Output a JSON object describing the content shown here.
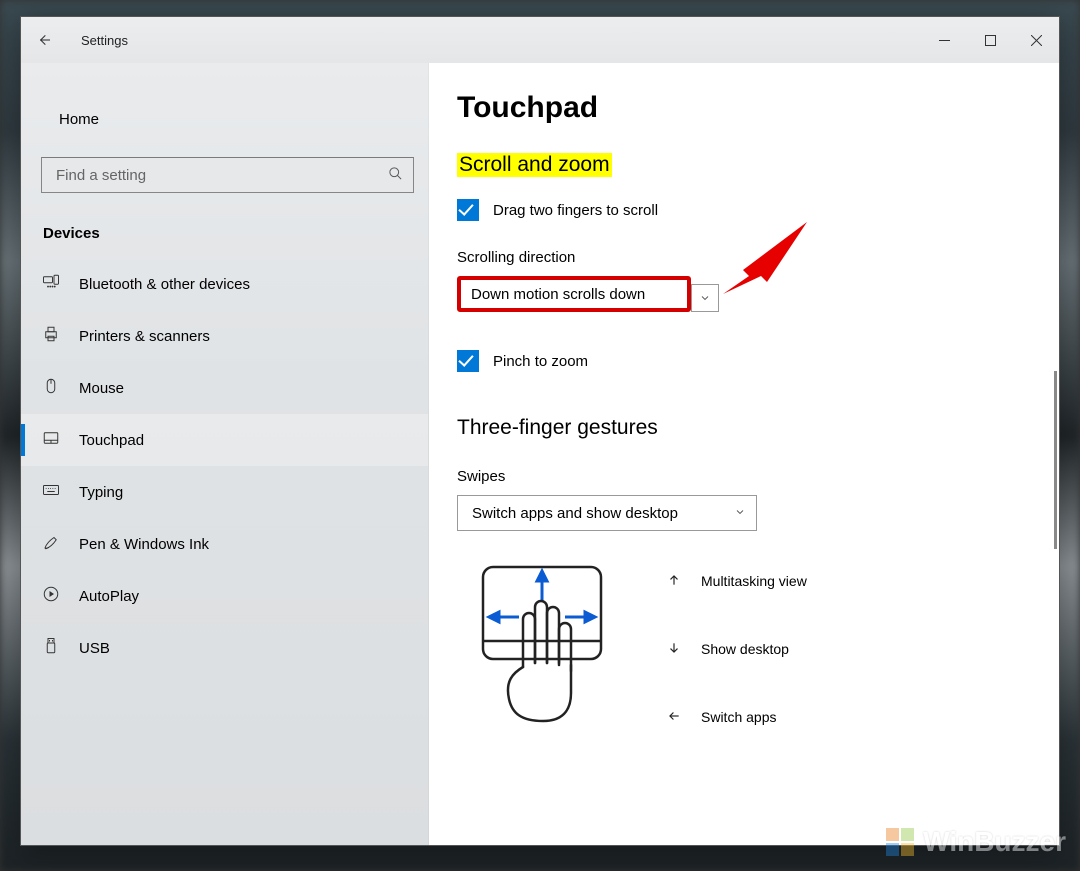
{
  "window": {
    "title": "Settings"
  },
  "sidebar": {
    "home_label": "Home",
    "search_placeholder": "Find a setting",
    "category": "Devices",
    "items": [
      {
        "label": "Bluetooth & other devices"
      },
      {
        "label": "Printers & scanners"
      },
      {
        "label": "Mouse"
      },
      {
        "label": "Touchpad",
        "selected": true
      },
      {
        "label": "Typing"
      },
      {
        "label": "Pen & Windows Ink"
      },
      {
        "label": "AutoPlay"
      },
      {
        "label": "USB"
      }
    ]
  },
  "main": {
    "page_title": "Touchpad",
    "section_scroll": "Scroll and zoom",
    "drag_two_fingers": "Drag two fingers to scroll",
    "scroll_dir_label": "Scrolling direction",
    "scroll_dir_value": "Down motion scrolls down",
    "pinch_to_zoom": "Pinch to zoom",
    "section_three": "Three-finger gestures",
    "swipes_label": "Swipes",
    "swipes_value": "Switch apps and show desktop",
    "gestures": {
      "up": "Multitasking view",
      "down": "Show desktop",
      "left": "Switch apps"
    }
  },
  "watermark": "WinBuzzer"
}
